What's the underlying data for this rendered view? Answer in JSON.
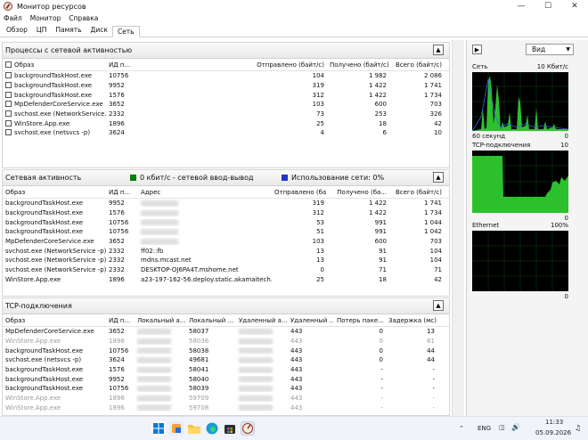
{
  "window": {
    "title": "Монитор ресурсов"
  },
  "menu": [
    "Файл",
    "Монитор",
    "Справка"
  ],
  "tabs": [
    "Обзор",
    "ЦП",
    "Память",
    "Диск",
    "Сеть"
  ],
  "processes": {
    "title": "Процессы с сетевой активностью",
    "headers": [
      "Образ",
      "ИД п...",
      "Отправлено (байт/с)",
      "Получено (байт/с)",
      "Всего (байт/с)"
    ],
    "rows": [
      [
        "backgroundTaskHost.exe",
        "10756",
        "104",
        "1 982",
        "2 086"
      ],
      [
        "backgroundTaskHost.exe",
        "9952",
        "319",
        "1 422",
        "1 741"
      ],
      [
        "backgroundTaskHost.exe",
        "1576",
        "312",
        "1 422",
        "1 734"
      ],
      [
        "MpDefenderCoreService.exe",
        "3652",
        "103",
        "600",
        "703"
      ],
      [
        "svchost.exe (NetworkService...",
        "2332",
        "73",
        "253",
        "326"
      ],
      [
        "WinStore.App.exe",
        "1896",
        "25",
        "18",
        "42"
      ],
      [
        "svchost.exe (netsvcs -p)",
        "3624",
        "4",
        "6",
        "10"
      ]
    ]
  },
  "netactivity": {
    "title": "Сетевая активность",
    "io_label": "0 кбит/с - сетевой ввод-вывод",
    "usage_label": "Использование сети: 0%",
    "headers": [
      "Образ",
      "ИД п...",
      "Адрес",
      "Отправлено (ба...",
      "Получено (ба...",
      "Всего (байт/с)"
    ],
    "rows": [
      {
        "image": "backgroundTaskHost.exe",
        "pid": "9952",
        "address": "",
        "sent": "319",
        "recv": "1 422",
        "total": "1 741"
      },
      {
        "image": "backgroundTaskHost.exe",
        "pid": "1576",
        "address": "",
        "sent": "312",
        "recv": "1 422",
        "total": "1 734"
      },
      {
        "image": "backgroundTaskHost.exe",
        "pid": "10756",
        "address": "",
        "sent": "53",
        "recv": "991",
        "total": "1 044"
      },
      {
        "image": "backgroundTaskHost.exe",
        "pid": "10756",
        "address": "",
        "sent": "51",
        "recv": "991",
        "total": "1 042"
      },
      {
        "image": "MpDefenderCoreService.exe",
        "pid": "3652",
        "address": "",
        "sent": "103",
        "recv": "600",
        "total": "703"
      },
      {
        "image": "svchost.exe (NetworkService -p)",
        "pid": "2332",
        "address": "ff02::fb",
        "sent": "13",
        "recv": "91",
        "total": "104"
      },
      {
        "image": "svchost.exe (NetworkService -p)",
        "pid": "2332",
        "address": "mdns.mcast.net",
        "sent": "13",
        "recv": "91",
        "total": "104"
      },
      {
        "image": "svchost.exe (NetworkService -p)",
        "pid": "2332",
        "address": "DESKTOP-OJ6PA4T.mshome.net",
        "sent": "0",
        "recv": "71",
        "total": "71"
      },
      {
        "image": "WinStore.App.exe",
        "pid": "1896",
        "address": "a23-197-162-56.deploy.static.akamaitech...",
        "sent": "25",
        "recv": "18",
        "total": "42"
      }
    ]
  },
  "tcp": {
    "title": "TCP-подключения",
    "headers": [
      "Образ",
      "ИД п...",
      "Локальный а...",
      "Локальный ...",
      "Удаленный а...",
      "Удаленный ...",
      "Потерь паке...",
      "Задержка (мс)"
    ],
    "rows": [
      {
        "image": "MpDefenderCoreService.exe",
        "pid": "3652",
        "lport": "58037",
        "rport": "443",
        "loss": "0",
        "lat": "13",
        "dim": false
      },
      {
        "image": "WinStore.App.exe",
        "pid": "1896",
        "lport": "58036",
        "rport": "443",
        "loss": "0",
        "lat": "61",
        "dim": true
      },
      {
        "image": "backgroundTaskHost.exe",
        "pid": "10756",
        "lport": "58038",
        "rport": "443",
        "loss": "0",
        "lat": "44",
        "dim": false
      },
      {
        "image": "svchost.exe (netsvcs -p)",
        "pid": "3624",
        "lport": "49681",
        "rport": "443",
        "loss": "0",
        "lat": "44",
        "dim": false
      },
      {
        "image": "backgroundTaskHost.exe",
        "pid": "1576",
        "lport": "58041",
        "rport": "443",
        "loss": "-",
        "lat": "-",
        "dim": false
      },
      {
        "image": "backgroundTaskHost.exe",
        "pid": "9952",
        "lport": "58040",
        "rport": "443",
        "loss": "-",
        "lat": "-",
        "dim": false
      },
      {
        "image": "backgroundTaskHost.exe",
        "pid": "10756",
        "lport": "58039",
        "rport": "443",
        "loss": "-",
        "lat": "-",
        "dim": false
      },
      {
        "image": "WinStore.App.exe",
        "pid": "1896",
        "lport": "59709",
        "rport": "443",
        "loss": "-",
        "lat": "-",
        "dim": true
      },
      {
        "image": "WinStore.App.exe",
        "pid": "1896",
        "lport": "59708",
        "rport": "443",
        "loss": "-",
        "lat": "-",
        "dim": true
      }
    ]
  },
  "sidebar": {
    "view_label": "Вид",
    "graphs": [
      {
        "name": "Сеть",
        "right": "10 Кбит/с",
        "bottom_left": "60 секунд",
        "bottom_right": "0"
      },
      {
        "name": "TCP-подключения",
        "right": "10",
        "bottom_left": "",
        "bottom_right": "0"
      },
      {
        "name": "Ethernet",
        "right": "100%",
        "bottom_left": "",
        "bottom_right": "0"
      }
    ]
  },
  "taskbar": {
    "lang": "ENG",
    "time": "11:33",
    "date": "05.09.2026"
  },
  "colors": {
    "graph_green": "#22c822",
    "io_legend": "#0a7d0a",
    "usage_legend": "#1c37c5"
  }
}
